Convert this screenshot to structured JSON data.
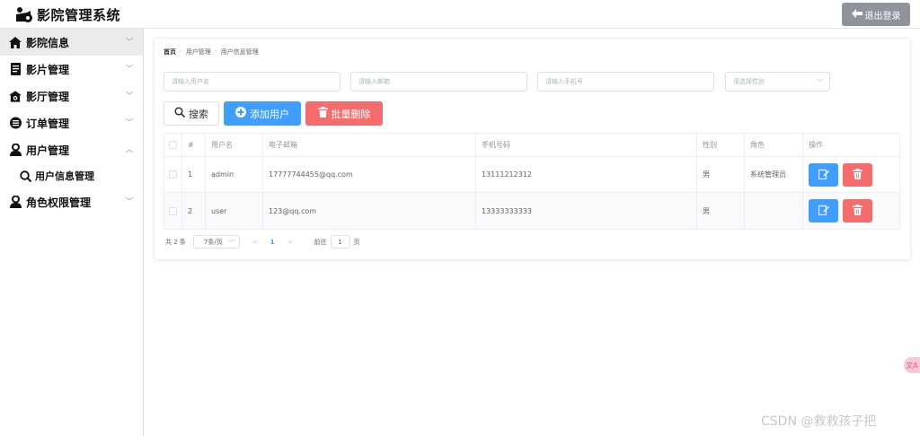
{
  "header": {
    "app_title": "影院管理系统",
    "logout_label": "退出登录"
  },
  "sidebar": {
    "items": [
      {
        "label": "影院信息",
        "icon": "home-icon"
      },
      {
        "label": "影片管理",
        "icon": "document-icon"
      },
      {
        "label": "影厅管理",
        "icon": "hall-icon"
      },
      {
        "label": "订单管理",
        "icon": "order-icon"
      },
      {
        "label": "用户管理",
        "icon": "user-icon"
      },
      {
        "label": "角色权限管理",
        "icon": "role-icon"
      }
    ],
    "submenu": {
      "label": "用户信息管理",
      "icon": "search-user-icon"
    }
  },
  "breadcrumb": [
    "首页",
    "用户管理",
    "用户信息管理"
  ],
  "filters": {
    "username_placeholder": "请输入用户名",
    "email_placeholder": "请输入邮箱",
    "phone_placeholder": "请输入手机号",
    "gender_placeholder": "请选择性别"
  },
  "actions": {
    "search": "搜索",
    "add_user": "添加用户",
    "batch_delete": "批量删除"
  },
  "table": {
    "headers": [
      "#",
      "用户名",
      "电子邮箱",
      "手机号码",
      "性别",
      "角色",
      "操作"
    ],
    "rows": [
      {
        "index": "1",
        "username": "admin",
        "email": "17777744455@qq.com",
        "phone": "13111212312",
        "gender": "男",
        "role": "系统管理员"
      },
      {
        "index": "2",
        "username": "user",
        "email": "123@qq.com",
        "phone": "13333333333",
        "gender": "男",
        "role": ""
      }
    ]
  },
  "pagination": {
    "total": "共 2 条",
    "page_size": "7条/页",
    "prev": "<",
    "current": "1",
    "next": ">",
    "goto_label": "前往",
    "goto_value": "1",
    "page_suffix": "页"
  },
  "float_badge": "文A",
  "watermark": "CSDN @救救孩子把",
  "colors": {
    "primary": "#409eff",
    "danger": "#f56c6c",
    "logout": "#909399",
    "active_menu_bg": "#ebebeb"
  }
}
